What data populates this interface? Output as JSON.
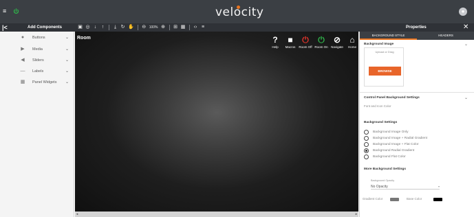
{
  "app": {
    "logo_text": "velocity",
    "menu_glyph": "≡",
    "power_glyph": "⏻",
    "user_glyph": "●"
  },
  "left_panel": {
    "collapse_glyph": "|<",
    "title": "Add Components",
    "items": [
      {
        "label": "Buttons",
        "icon": "●",
        "icon_name": "button-icon"
      },
      {
        "label": "Media",
        "icon": "▶",
        "icon_name": "media-icon"
      },
      {
        "label": "Sliders",
        "icon": "◀",
        "icon_name": "slider-icon"
      },
      {
        "label": "Labels",
        "icon": "—",
        "icon_name": "label-icon"
      },
      {
        "label": "Panel Widgets",
        "icon": "▦",
        "icon_name": "widgets-icon"
      }
    ],
    "chevron": "⌄"
  },
  "toolbar": {
    "image_icon": "▣",
    "settings_icon": "◎",
    "download_icon": "↓",
    "upload_icon": "↑",
    "import_icon": "⤓",
    "refresh_icon": "↻",
    "hand_icon": "✋",
    "zoom_out_icon": "⊖",
    "zoom_level": "100%",
    "zoom_in_icon": "⊕",
    "align_icon": "⊞",
    "grid_icon": "▦",
    "code_icon": "‹›",
    "distribute_icon": "≡"
  },
  "canvas": {
    "room_title": "Room",
    "nav": [
      {
        "label": "Help",
        "glyph": "?",
        "icon_name": "help-icon",
        "color": "#ffffff"
      },
      {
        "label": "Macros",
        "glyph": "■",
        "icon_name": "macros-icon",
        "color": "#ffffff"
      },
      {
        "label": "Room Off",
        "glyph": "⏻",
        "icon_name": "room-off-icon",
        "color": "#e0342b"
      },
      {
        "label": "Room On",
        "glyph": "⏻",
        "icon_name": "room-on-icon",
        "color": "#2fb24a"
      },
      {
        "label": "Navigate",
        "glyph": "⊘",
        "icon_name": "navigate-icon",
        "color": "#ffffff"
      },
      {
        "label": "Home",
        "glyph": "⌂",
        "icon_name": "home-icon",
        "color": "#ffffff"
      }
    ],
    "scroll_left": "◂",
    "scroll_right": "▸"
  },
  "properties": {
    "title": "Properties",
    "close_glyph": "✕",
    "tabs": [
      "BACKGROUND STYLE",
      "HEADERS"
    ],
    "background_image": {
      "title": "Background Image",
      "upload_label": "Upload or Drag",
      "browse_label": "BROWSE"
    },
    "control_panel": {
      "title": "Control Panel Background Settings",
      "subtitle": "Font and Icon Color"
    },
    "background_settings": {
      "title": "Background Settings",
      "options": [
        "Background Image Only",
        "Background Image + Radial Gradient",
        "Background Image + Flat Color",
        "Background Radial Gradient",
        "Background Flat Color"
      ],
      "selected_index": 3
    },
    "more_settings": {
      "title": "More Background Settings",
      "opacity_label": "Background Opacity",
      "opacity_value": "No Opacity",
      "gradient_color_label": "Gradient Color",
      "gradient_color": "#777777",
      "base_color_label": "Base Color",
      "base_color": "#000000"
    },
    "chevron": "⌄"
  },
  "colors": {
    "accent": "#e8731e",
    "topbar": "#3b3f44",
    "power_green": "#2fb24a"
  }
}
